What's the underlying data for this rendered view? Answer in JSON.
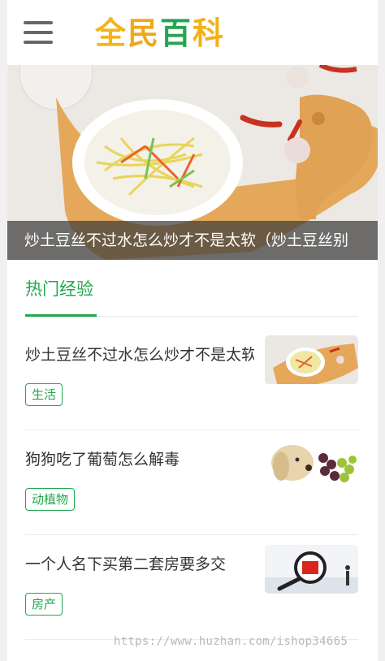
{
  "header": {
    "logo_chars": [
      "全",
      "民",
      "百",
      "科"
    ],
    "logo_colors": [
      "#f3b51b",
      "#f0a81a",
      "#24a552",
      "#f0b11a"
    ]
  },
  "banner": {
    "caption": "炒土豆丝不过水怎么炒才不是太软（炒土豆丝别"
  },
  "section": {
    "title": "热门经验"
  },
  "articles": [
    {
      "title": "炒土豆丝不过水怎么炒才不是太软",
      "tag": "生活",
      "thumb_icon": "potato-dish-thumbnail"
    },
    {
      "title": "狗狗吃了葡萄怎么解毒",
      "tag": "动植物",
      "thumb_icon": "dog-grapes-thumbnail"
    },
    {
      "title": "一个人名下买第二套房要多交",
      "tag": "房产",
      "thumb_icon": "tax-magnifier-thumbnail"
    }
  ],
  "watermark": "https://www.huzhan.com/ishop34665"
}
